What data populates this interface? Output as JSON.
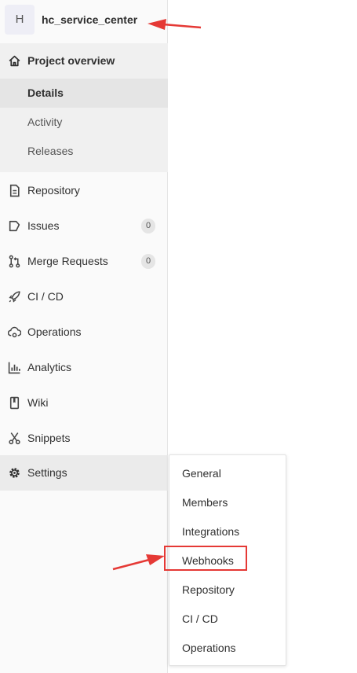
{
  "project": {
    "avatar_letter": "H",
    "name": "hc_service_center"
  },
  "nav": {
    "project_overview": "Project overview",
    "overview_sub": [
      "Details",
      "Activity",
      "Releases"
    ],
    "items": [
      {
        "label": "Repository",
        "icon": "file-icon"
      },
      {
        "label": "Issues",
        "icon": "issues-icon",
        "count": "0"
      },
      {
        "label": "Merge Requests",
        "icon": "merge-request-icon",
        "count": "0"
      },
      {
        "label": "CI / CD",
        "icon": "rocket-icon"
      },
      {
        "label": "Operations",
        "icon": "cloud-gear-icon"
      },
      {
        "label": "Analytics",
        "icon": "chart-icon"
      },
      {
        "label": "Wiki",
        "icon": "book-icon"
      },
      {
        "label": "Snippets",
        "icon": "scissors-icon"
      },
      {
        "label": "Settings",
        "icon": "gear-icon"
      }
    ]
  },
  "settings_menu": [
    "General",
    "Members",
    "Integrations",
    "Webhooks",
    "Repository",
    "CI / CD",
    "Operations"
  ],
  "annotation_color": "#e53935"
}
